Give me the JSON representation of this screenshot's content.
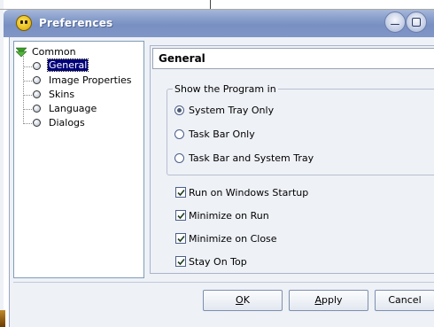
{
  "window": {
    "title": "Preferences"
  },
  "tree": {
    "root": "Common",
    "items": [
      {
        "label": "General",
        "selected": true
      },
      {
        "label": "Image Properties",
        "selected": false
      },
      {
        "label": "Skins",
        "selected": false
      },
      {
        "label": "Language",
        "selected": false
      },
      {
        "label": "Dialogs",
        "selected": false
      }
    ]
  },
  "panel": {
    "title": "General",
    "group_title": "Show the Program in",
    "radios": [
      {
        "label": "System Tray Only",
        "checked": true
      },
      {
        "label": "Task Bar Only",
        "checked": false
      },
      {
        "label": "Task Bar and System Tray",
        "checked": false
      }
    ],
    "checkboxes": [
      {
        "label": "Run on Windows Startup",
        "checked": true
      },
      {
        "label": "Minimize on Run",
        "checked": true
      },
      {
        "label": "Minimize on Close",
        "checked": true
      },
      {
        "label": "Stay On Top",
        "checked": true
      }
    ]
  },
  "buttons": {
    "ok": {
      "mnemonic": "O",
      "rest": "K"
    },
    "apply": {
      "mnemonic": "A",
      "rest": "pply"
    },
    "cancel": {
      "label": "Cancel"
    }
  },
  "colors": {
    "selection": "#00007a",
    "titlebar": "#8aa0cc"
  }
}
